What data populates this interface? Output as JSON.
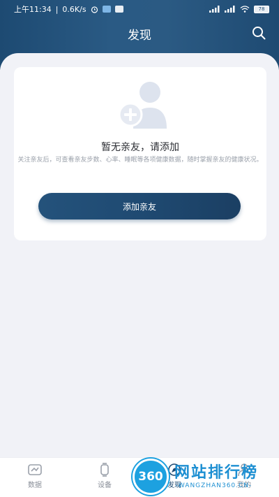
{
  "status_bar": {
    "time": "上午11:34",
    "speed": "0.6K/s",
    "battery": "78"
  },
  "header": {
    "title": "发现"
  },
  "empty_state": {
    "title": "暂无亲友，请添加",
    "description": "关注亲友后，可查看亲友步数、心率、睡眠等各项健康数据，随时掌握亲友的健康状况。",
    "button_label": "添加亲友"
  },
  "tabs": [
    {
      "label": "数据",
      "icon": "data-icon"
    },
    {
      "label": "设备",
      "icon": "watch-icon"
    },
    {
      "label": "发现",
      "icon": "discover-icon",
      "active": true
    },
    {
      "label": "我的",
      "icon": "profile-icon"
    }
  ],
  "watermark": {
    "badge": "360",
    "title": "网站排行榜",
    "subtitle": "-WANGZHAN360.CN-"
  },
  "colors": {
    "header_gradient": "#1d4a72",
    "accent": "#1f4a72",
    "panel_bg": "#f1f2f7",
    "watermark": "#1d8fd2"
  }
}
